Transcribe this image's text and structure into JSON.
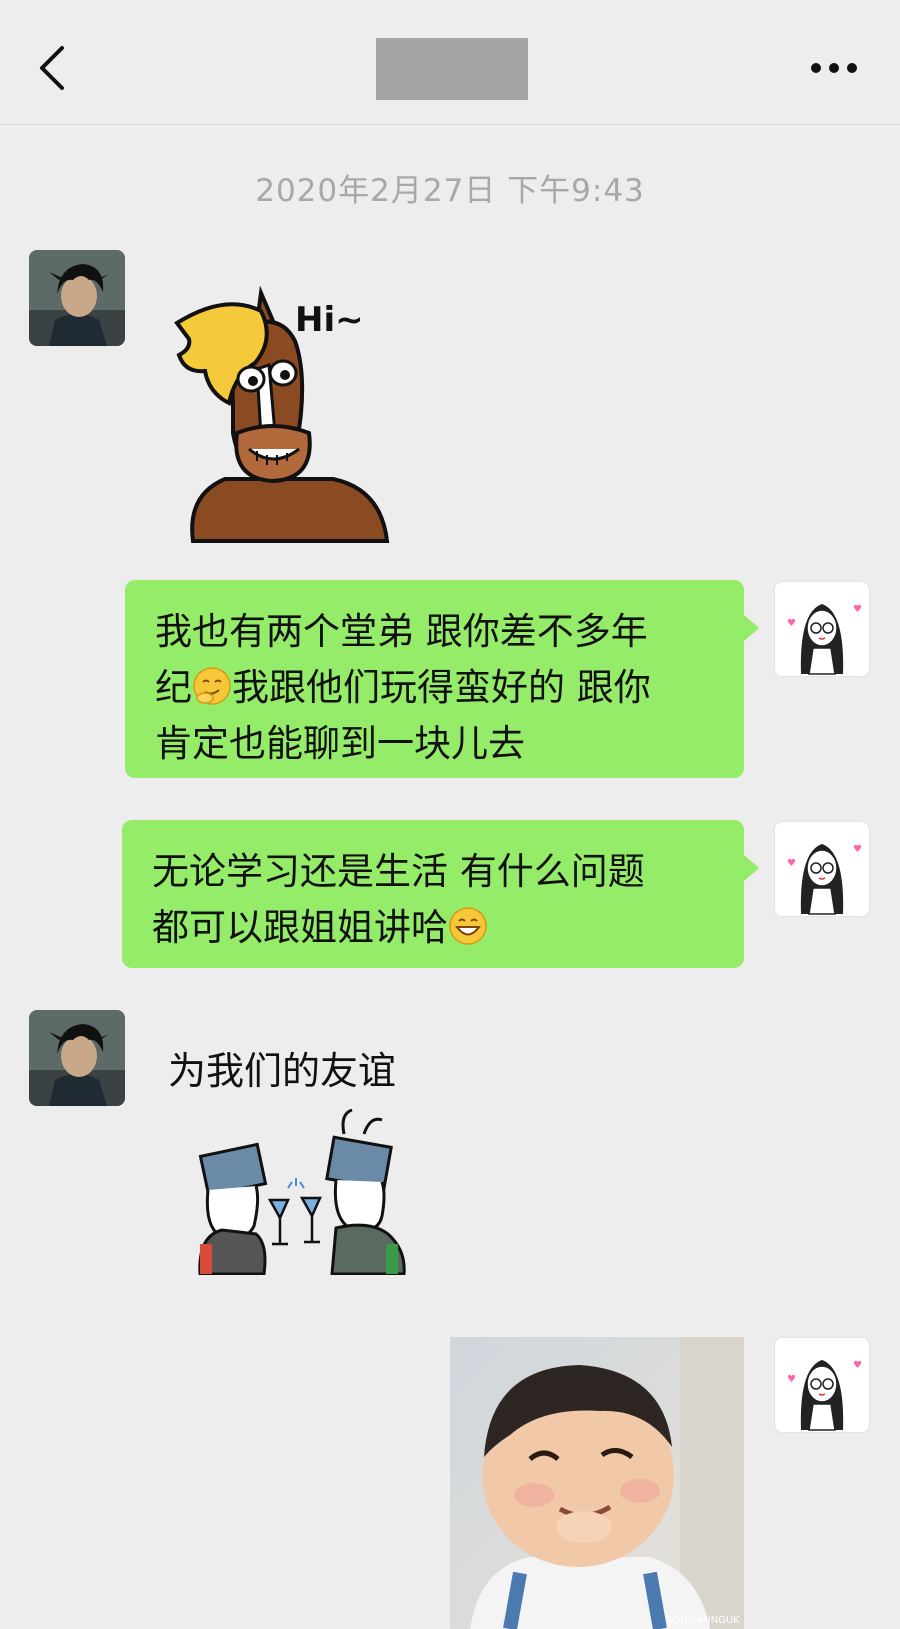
{
  "header": {
    "back_icon": "chevron-left-icon",
    "more_icon": "more-dots-icon"
  },
  "timestamp": "2020年2月27日 下午9:43",
  "messages": [
    {
      "side": "left",
      "kind": "sticker",
      "sticker_text": "Hi~"
    },
    {
      "side": "right",
      "kind": "text",
      "text_a": "我也有两个堂弟 跟你差不多年\n纪",
      "emoji_a": "smirk-emoji-icon",
      "text_b": "我跟他们玩得蛮好的 跟你\n肯定也能聊到一块儿去"
    },
    {
      "side": "right",
      "kind": "text",
      "text_a": "无论学习还是生活 有什么问题\n都可以跟姐姐讲哈",
      "emoji_a": "grin-emoji-icon"
    },
    {
      "side": "left",
      "kind": "sticker",
      "sticker_text": "为我们的友谊"
    },
    {
      "side": "right",
      "kind": "image",
      "watermark": "SONG-MINGUK"
    }
  ],
  "colors": {
    "background": "#ededed",
    "my_bubble": "#95ec69",
    "timestamp": "#a8a8a8"
  }
}
